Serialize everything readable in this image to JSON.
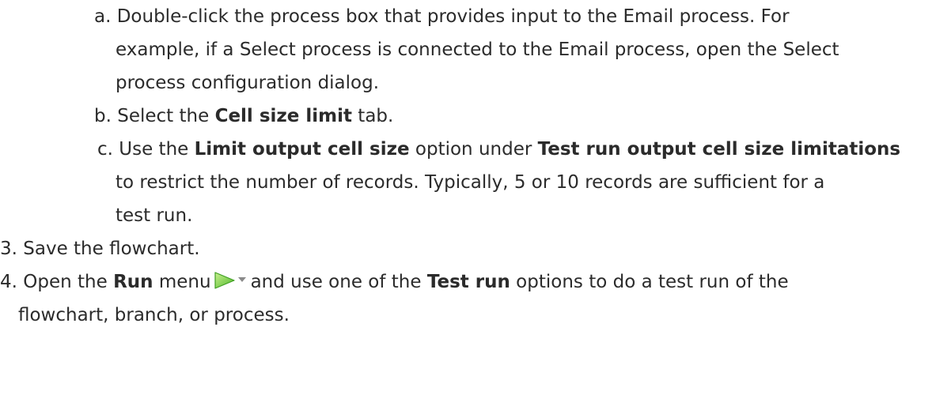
{
  "step2": {
    "a": {
      "marker": "a.",
      "line1": "Double-click the process box that provides input to the Email process. For",
      "line2": "example, if a Select process is connected to the Email process, open the Select",
      "line3": "process configuration dialog."
    },
    "b": {
      "marker": "b.",
      "pre": "Select the ",
      "bold": "Cell size limit",
      "post": " tab."
    },
    "c": {
      "marker": "c.",
      "pre": "Use the ",
      "bold1": "Limit output cell size",
      "mid": " option under ",
      "bold2": "Test run output cell size limitations",
      "line2": "to restrict the number of records. Typically, 5 or 10 records are sufficient for a",
      "line3": "test run."
    }
  },
  "step3": {
    "marker": "3.",
    "text": "Save the flowchart."
  },
  "step4": {
    "marker": "4.",
    "pre": "Open the ",
    "bold1": "Run",
    "mid1": " menu",
    "mid2": "and use one of the ",
    "bold2": "Test run",
    "post": " options to do a test run of the",
    "line2": "flowchart, branch, or process.",
    "run_icon": "run-play-dropdown-icon",
    "colors": {
      "play_green": "#5cc02f",
      "play_light": "#b6ea7a",
      "arrow_gray": "#8a8a8a"
    }
  }
}
